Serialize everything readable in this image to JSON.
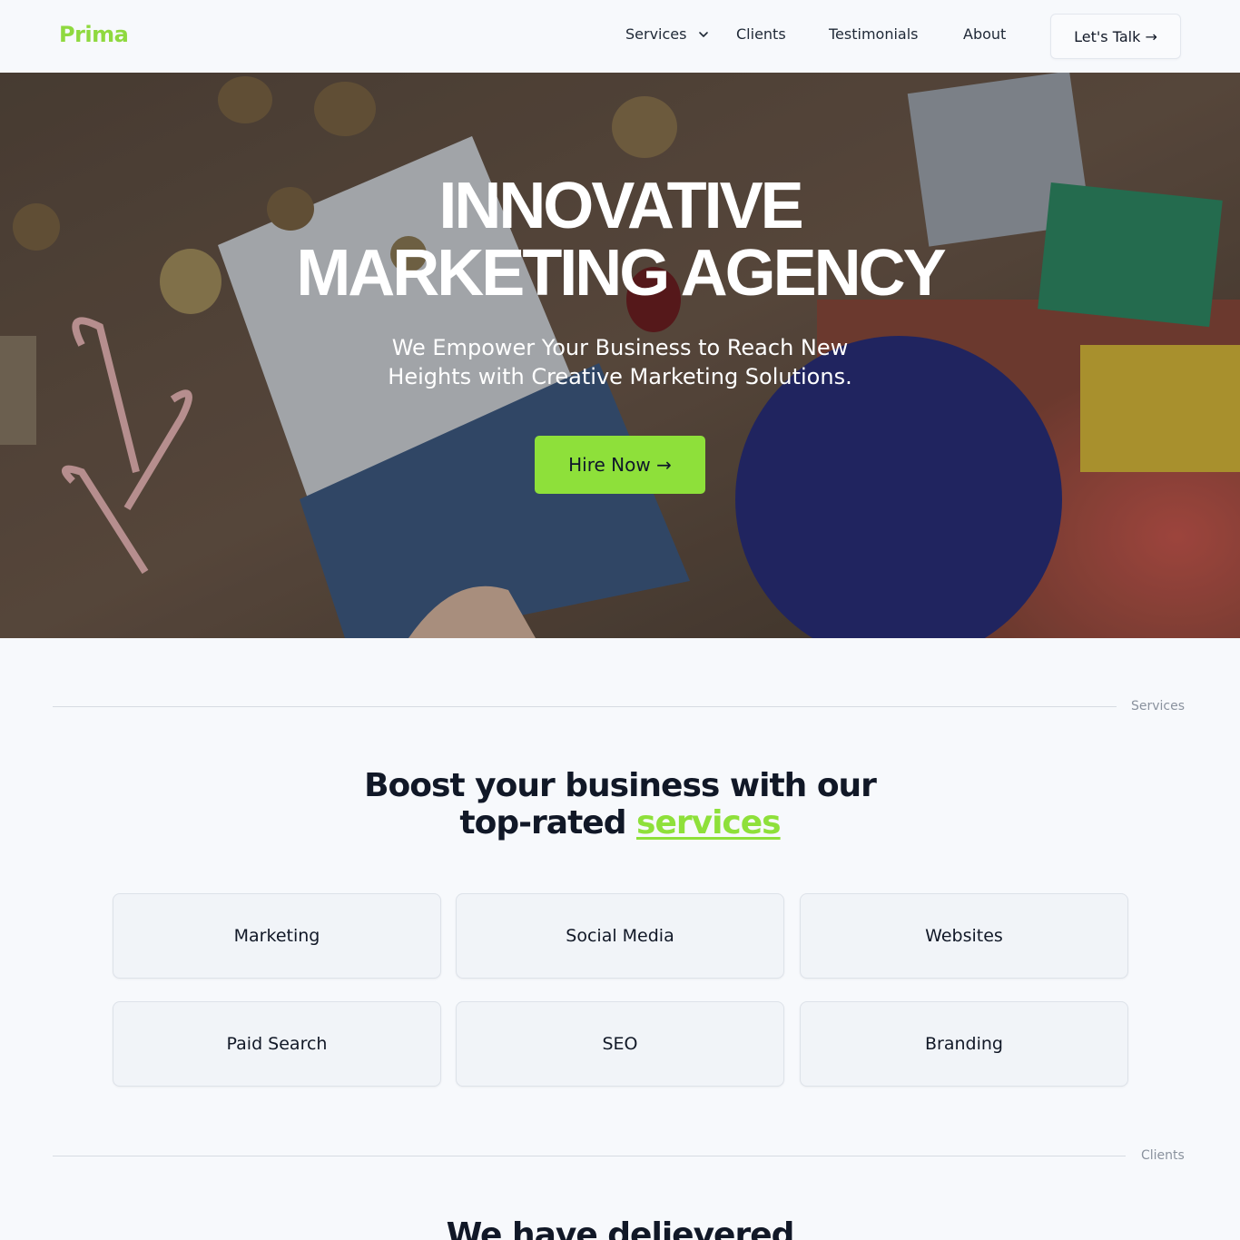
{
  "brand": {
    "name": "Prima",
    "accent_color": "#8ee03a"
  },
  "nav": {
    "items": [
      {
        "label": "Services"
      },
      {
        "label": "Clients"
      },
      {
        "label": "Testimonials"
      },
      {
        "label": "About"
      }
    ],
    "cta_label": "Let's Talk →"
  },
  "hero": {
    "title_line1": "INNOVATIVE",
    "title_line2": "MARKETING AGENCY",
    "subtitle": "We Empower Your Business to Reach New Heights with Creative Marketing Solutions.",
    "button_label": "Hire Now →"
  },
  "services_section": {
    "tag": "Services",
    "heading_part1": "Boost your business with our top-rated",
    "heading_highlight": "services",
    "cards": [
      {
        "label": "Marketing"
      },
      {
        "label": "Social Media"
      },
      {
        "label": "Websites"
      },
      {
        "label": "Paid Search"
      },
      {
        "label": "SEO"
      },
      {
        "label": "Branding"
      }
    ]
  },
  "clients_section": {
    "tag": "Clients",
    "heading": "We have delievered"
  }
}
